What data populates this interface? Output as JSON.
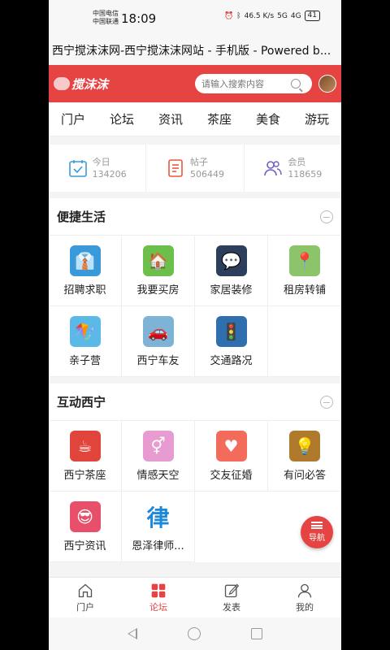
{
  "status": {
    "carrier1": "中国电信",
    "carrier2": "中国联通",
    "time": "18:09",
    "speed": "46.5 K/s",
    "net1": "5G",
    "net2": "4G",
    "battery": "41"
  },
  "page_title": "西宁搅沫沫网-西宁搅沫沫网站 - 手机版 - Powered b...",
  "header": {
    "logo": "搅沫沫",
    "search_placeholder": "请输入搜索内容"
  },
  "nav_tabs": [
    "门户",
    "论坛",
    "资讯",
    "茶座",
    "美食",
    "游玩"
  ],
  "stats": [
    {
      "label": "今日",
      "value": "134206",
      "icon": "calendar-icon"
    },
    {
      "label": "帖子",
      "value": "506449",
      "icon": "document-icon"
    },
    {
      "label": "会员",
      "value": "118659",
      "icon": "users-icon"
    }
  ],
  "sections": [
    {
      "title": "便捷生活",
      "items": [
        {
          "label": "招聘求职",
          "icon": "job-icon",
          "color": "#3a9ad9"
        },
        {
          "label": "我要买房",
          "icon": "house-icon",
          "color": "#6cbf4a"
        },
        {
          "label": "家居装修",
          "icon": "chat-icon",
          "color": "#2d3e5c"
        },
        {
          "label": "租房转铺",
          "icon": "map-pin-icon",
          "color": "#8cc46b"
        },
        {
          "label": "亲子营",
          "icon": "kite-icon",
          "color": "#5cb8e6"
        },
        {
          "label": "西宁车友",
          "icon": "car-icon",
          "color": "#7fb3d5"
        },
        {
          "label": "交通路况",
          "icon": "traffic-light-icon",
          "color": "#2f6fb0"
        }
      ]
    },
    {
      "title": "互动西宁",
      "items": [
        {
          "label": "西宁茶座",
          "icon": "tea-cup-icon",
          "color": "#e0443a"
        },
        {
          "label": "情感天空",
          "icon": "gender-icon",
          "color": "#e89bd0"
        },
        {
          "label": "交友征婚",
          "icon": "heart-chat-icon",
          "color": "#f26b5b"
        },
        {
          "label": "有问必答",
          "icon": "lightbulb-icon",
          "color": "#b07a2c"
        },
        {
          "label": "西宁资讯",
          "icon": "person-glasses-icon",
          "color": "#e84f6a"
        },
        {
          "label": "恩泽律师...",
          "icon": "law-icon",
          "color": "#ffffff",
          "glyph": "律"
        }
      ]
    }
  ],
  "float_nav": "导航",
  "tabbar": [
    {
      "label": "门户",
      "icon": "home-icon",
      "active": false
    },
    {
      "label": "论坛",
      "icon": "grid-icon",
      "active": true
    },
    {
      "label": "发表",
      "icon": "edit-icon",
      "active": false
    },
    {
      "label": "我的",
      "icon": "user-icon",
      "active": false
    }
  ],
  "colors": {
    "accent": "#e64343"
  }
}
